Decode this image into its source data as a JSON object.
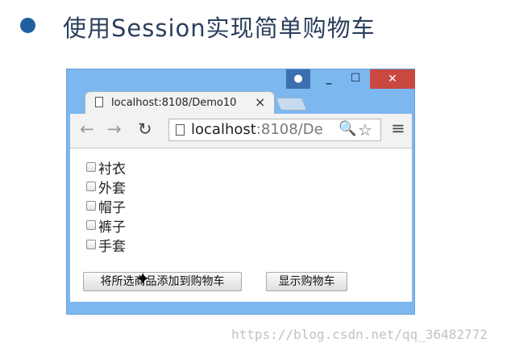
{
  "slide": {
    "title": "使用Session实现简单购物车"
  },
  "window": {
    "user_icon": "person-icon",
    "minimize_label": "_",
    "maximize_label": "☐",
    "close_label": "✕"
  },
  "tab": {
    "title": "localhost:8108/Demo10",
    "close_label": "×"
  },
  "toolbar": {
    "back_label": "←",
    "forward_label": "→",
    "reload_label": "↻",
    "url_host": "localhost",
    "url_rest": ":8108/De",
    "zoom_label": "🔍",
    "star_label": "☆",
    "menu_label": "≡"
  },
  "products": [
    {
      "label": "衬衣",
      "checked": false
    },
    {
      "label": "外套",
      "checked": false
    },
    {
      "label": "帽子",
      "checked": false
    },
    {
      "label": "裤子",
      "checked": false
    },
    {
      "label": "手套",
      "checked": false
    }
  ],
  "buttons": {
    "add_to_cart": "将所选商品添加到购物车",
    "show_cart": "显示购物车"
  },
  "watermark": "https://blog.csdn.net/qq_36482772"
}
